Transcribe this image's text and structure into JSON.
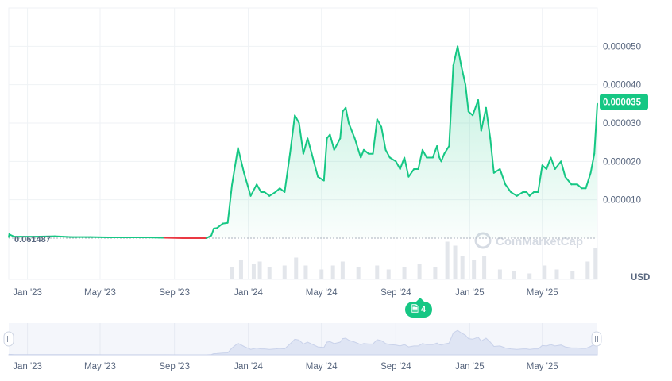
{
  "chart_data": {
    "type": "area",
    "currency_label": "USD",
    "start_price_label": "0.061487",
    "current_price_label": "0.000035",
    "current_price": 3.55e-05,
    "y_ticks": [
      "0.000010",
      "0.000020",
      "0.000030",
      "0.000040",
      "0.000050"
    ],
    "y_tick_values": [
      1e-05,
      2e-05,
      3e-05,
      4e-05,
      5e-05
    ],
    "ylim": [
      0,
      6e-05
    ],
    "x_tick_labels": [
      "Jan '23",
      "May '23",
      "Sep '23",
      "Jan '24",
      "May '24",
      "Sep '24",
      "Jan '25",
      "May '25"
    ],
    "x_tick_dates": [
      "2023-01-01",
      "2023-05-01",
      "2023-09-01",
      "2024-01-01",
      "2024-05-01",
      "2024-09-01",
      "2025-01-01",
      "2025-05-01"
    ],
    "x_range": [
      "2022-12-01",
      "2025-07-31"
    ],
    "grid": true,
    "colors": {
      "line": "#16c784",
      "below_line": "#ea3943",
      "baseline": "#aab2bd",
      "volume": "#d7dbe2",
      "navigator_fill": "#e2e8f6"
    },
    "series": [
      {
        "dates": [
          "2022-12-01",
          "2022-12-02",
          "2022-12-03",
          "2022-12-10",
          "2022-12-20",
          "2023-01-15",
          "2023-02-15",
          "2023-03-15",
          "2023-04-15",
          "2023-05-15",
          "2023-06-15",
          "2023-07-15",
          "2023-08-15",
          "2023-09-15",
          "2023-10-15",
          "2023-10-24",
          "2023-11-01",
          "2023-11-05",
          "2023-11-10",
          "2023-11-20",
          "2023-11-28",
          "2023-12-05",
          "2023-12-15",
          "2023-12-25",
          "2024-01-05",
          "2024-01-15",
          "2024-01-22",
          "2024-01-28",
          "2024-02-05",
          "2024-02-15",
          "2024-02-22",
          "2024-03-01",
          "2024-03-10",
          "2024-03-18",
          "2024-03-25",
          "2024-04-01",
          "2024-04-08",
          "2024-04-15",
          "2024-04-25",
          "2024-05-05",
          "2024-05-10",
          "2024-05-15",
          "2024-05-22",
          "2024-06-01",
          "2024-06-05",
          "2024-06-10",
          "2024-06-15",
          "2024-06-25",
          "2024-07-05",
          "2024-07-10",
          "2024-07-18",
          "2024-07-25",
          "2024-08-01",
          "2024-08-08",
          "2024-08-15",
          "2024-08-22",
          "2024-09-01",
          "2024-09-08",
          "2024-09-15",
          "2024-09-22",
          "2024-10-01",
          "2024-10-08",
          "2024-10-15",
          "2024-10-22",
          "2024-11-01",
          "2024-11-08",
          "2024-11-12",
          "2024-11-15",
          "2024-11-20",
          "2024-11-28",
          "2024-12-05",
          "2024-12-12",
          "2024-12-18",
          "2024-12-25",
          "2024-12-30",
          "2025-01-06",
          "2025-01-15",
          "2025-01-20",
          "2025-01-28",
          "2025-02-04",
          "2025-02-10",
          "2025-02-20",
          "2025-03-01",
          "2025-03-10",
          "2025-03-20",
          "2025-03-30",
          "2025-04-05",
          "2025-04-10",
          "2025-04-17",
          "2025-04-24",
          "2025-05-01",
          "2025-05-08",
          "2025-05-15",
          "2025-05-22",
          "2025-06-01",
          "2025-06-08",
          "2025-06-18",
          "2025-06-28",
          "2025-07-05",
          "2025-07-12",
          "2025-07-20",
          "2025-07-26",
          "2025-07-31"
        ],
        "values": [
          3e-07,
          1.1e-06,
          9e-07,
          4e-07,
          4e-07,
          4e-07,
          5e-07,
          3e-07,
          3e-07,
          2e-07,
          2e-07,
          2e-07,
          1e-07,
          0.0,
          0.0,
          0.0,
          7e-07,
          2.5e-06,
          2.6e-06,
          3.8e-06,
          4e-06,
          1.38e-05,
          2.35e-05,
          1.7e-05,
          1.1e-05,
          1.4e-05,
          1.2e-05,
          1.2e-05,
          1.1e-05,
          1.2e-05,
          1.3e-05,
          1.2e-05,
          2.2e-05,
          3.2e-05,
          3e-05,
          2.2e-05,
          2.6e-05,
          2.2e-05,
          1.6e-05,
          1.5e-05,
          2.6e-05,
          2.7e-05,
          2.3e-05,
          2.6e-05,
          3.3e-05,
          3.4e-05,
          3e-05,
          2.6e-05,
          2.1e-05,
          2.3e-05,
          2.2e-05,
          2.2e-05,
          3.1e-05,
          2.9e-05,
          2.3e-05,
          2.1e-05,
          2e-05,
          1.8e-05,
          2.1e-05,
          1.6e-05,
          1.8e-05,
          1.8e-05,
          2.3e-05,
          2.1e-05,
          2.1e-05,
          2.4e-05,
          2.1e-05,
          2e-05,
          2.2e-05,
          2.4e-05,
          4.5e-05,
          5e-05,
          4.5e-05,
          4e-05,
          3.3e-05,
          3.2e-05,
          3.6e-05,
          2.8e-05,
          3.4e-05,
          2.6e-05,
          1.7e-05,
          1.8e-05,
          1.4e-05,
          1.2e-05,
          1.1e-05,
          1.2e-05,
          1.2e-05,
          1.1e-05,
          1.2e-05,
          1.2e-05,
          1.9e-05,
          1.8e-05,
          2.1e-05,
          1.8e-05,
          2e-05,
          1.6e-05,
          1.4e-05,
          1.4e-05,
          1.3e-05,
          1.3e-05,
          1.7e-05,
          2.2e-05,
          3.5e-05
        ]
      }
    ],
    "volume": [
      {
        "date": "2023-12-05",
        "v": 0.3
      },
      {
        "date": "2023-12-20",
        "v": 0.5
      },
      {
        "date": "2024-01-10",
        "v": 0.4
      },
      {
        "date": "2024-01-20",
        "v": 0.45
      },
      {
        "date": "2024-02-05",
        "v": 0.3
      },
      {
        "date": "2024-03-01",
        "v": 0.35
      },
      {
        "date": "2024-03-20",
        "v": 0.55
      },
      {
        "date": "2024-04-05",
        "v": 0.35
      },
      {
        "date": "2024-05-01",
        "v": 0.25
      },
      {
        "date": "2024-05-20",
        "v": 0.35
      },
      {
        "date": "2024-06-05",
        "v": 0.45
      },
      {
        "date": "2024-07-01",
        "v": 0.3
      },
      {
        "date": "2024-08-01",
        "v": 0.35
      },
      {
        "date": "2024-08-20",
        "v": 0.25
      },
      {
        "date": "2024-09-15",
        "v": 0.3
      },
      {
        "date": "2024-10-10",
        "v": 0.4
      },
      {
        "date": "2024-11-05",
        "v": 0.3
      },
      {
        "date": "2024-11-25",
        "v": 0.95
      },
      {
        "date": "2024-12-08",
        "v": 0.85
      },
      {
        "date": "2024-12-20",
        "v": 0.6
      },
      {
        "date": "2025-01-08",
        "v": 0.5
      },
      {
        "date": "2025-01-25",
        "v": 0.6
      },
      {
        "date": "2025-02-20",
        "v": 0.25
      },
      {
        "date": "2025-03-15",
        "v": 0.2
      },
      {
        "date": "2025-04-10",
        "v": 0.15
      },
      {
        "date": "2025-05-05",
        "v": 0.35
      },
      {
        "date": "2025-05-25",
        "v": 0.25
      },
      {
        "date": "2025-06-20",
        "v": 0.2
      },
      {
        "date": "2025-07-15",
        "v": 0.45
      },
      {
        "date": "2025-07-28",
        "v": 0.8
      }
    ]
  },
  "watermark": "CoinMarketCap",
  "notes_count": "4"
}
